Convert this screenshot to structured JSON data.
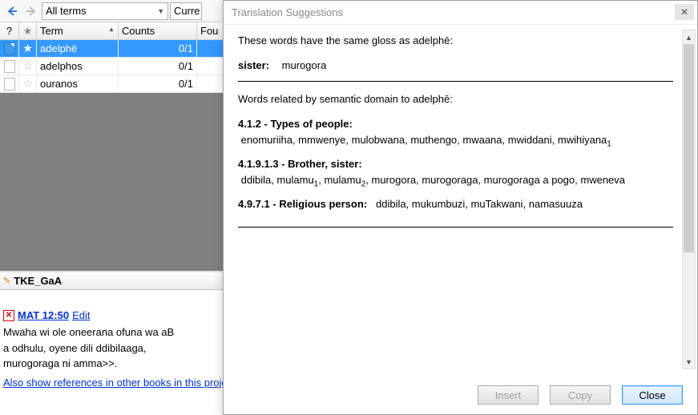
{
  "toolbar": {
    "all_terms": "All terms",
    "curr": "Curre"
  },
  "grid": {
    "headers": {
      "q": "?",
      "star": "★",
      "term": "Term",
      "counts": "Counts",
      "fou": "Fou"
    },
    "rows": [
      {
        "term": "adelphē",
        "counts": "0/1",
        "selected": true
      },
      {
        "term": "adelphos",
        "counts": "0/1",
        "selected": false
      },
      {
        "term": "ouranos",
        "counts": "0/1",
        "selected": false
      }
    ]
  },
  "project_bar": {
    "name": "TKE_GaA"
  },
  "verse": {
    "ref": "MAT 12:50",
    "edit": "Edit",
    "text": "Mwaha wi ole oneerana ofuna wa aBaabaanya, odhulu dili ddibilaaga, murogoraga ni amma>>.",
    "text_l1": "Mwaha wi ole oneerana ofuna wa aB",
    "text_l2": "a odhulu, oyene dili ddibilaaga,",
    "text_l3": "murogoraga ni amma>>.",
    "footer": "Also show references in other books in this project"
  },
  "dialog": {
    "title": "Translation Suggestions",
    "intro": "These words have the same gloss as adelphē:",
    "gloss_label": "sister:",
    "gloss_value": "murogora",
    "related_intro": "Words related by semantic domain to adelphē:",
    "domains": [
      {
        "code": "4.1.2",
        "name": "Types of people",
        "words": "enomuriiha, mmwenye, mulobwana, muthengo, mwaana, mwiddani, mwihiyana",
        "sub": "1"
      },
      {
        "code": "4.1.9.1.3",
        "name": "Brother, sister",
        "words_a": "ddibila, mulamu",
        "sub_a": "1",
        "words_b": ", mulamu",
        "sub_b": "2",
        "words_c": ", murogora, murogoraga, murogoraga a pogo, mweneva"
      },
      {
        "code": "4.9.7.1",
        "name": "Religious person",
        "words": "ddibila, mukumbuzi, muTakwani, namasuuza"
      }
    ],
    "buttons": {
      "insert": "Insert",
      "copy": "Copy",
      "close": "Close"
    }
  }
}
